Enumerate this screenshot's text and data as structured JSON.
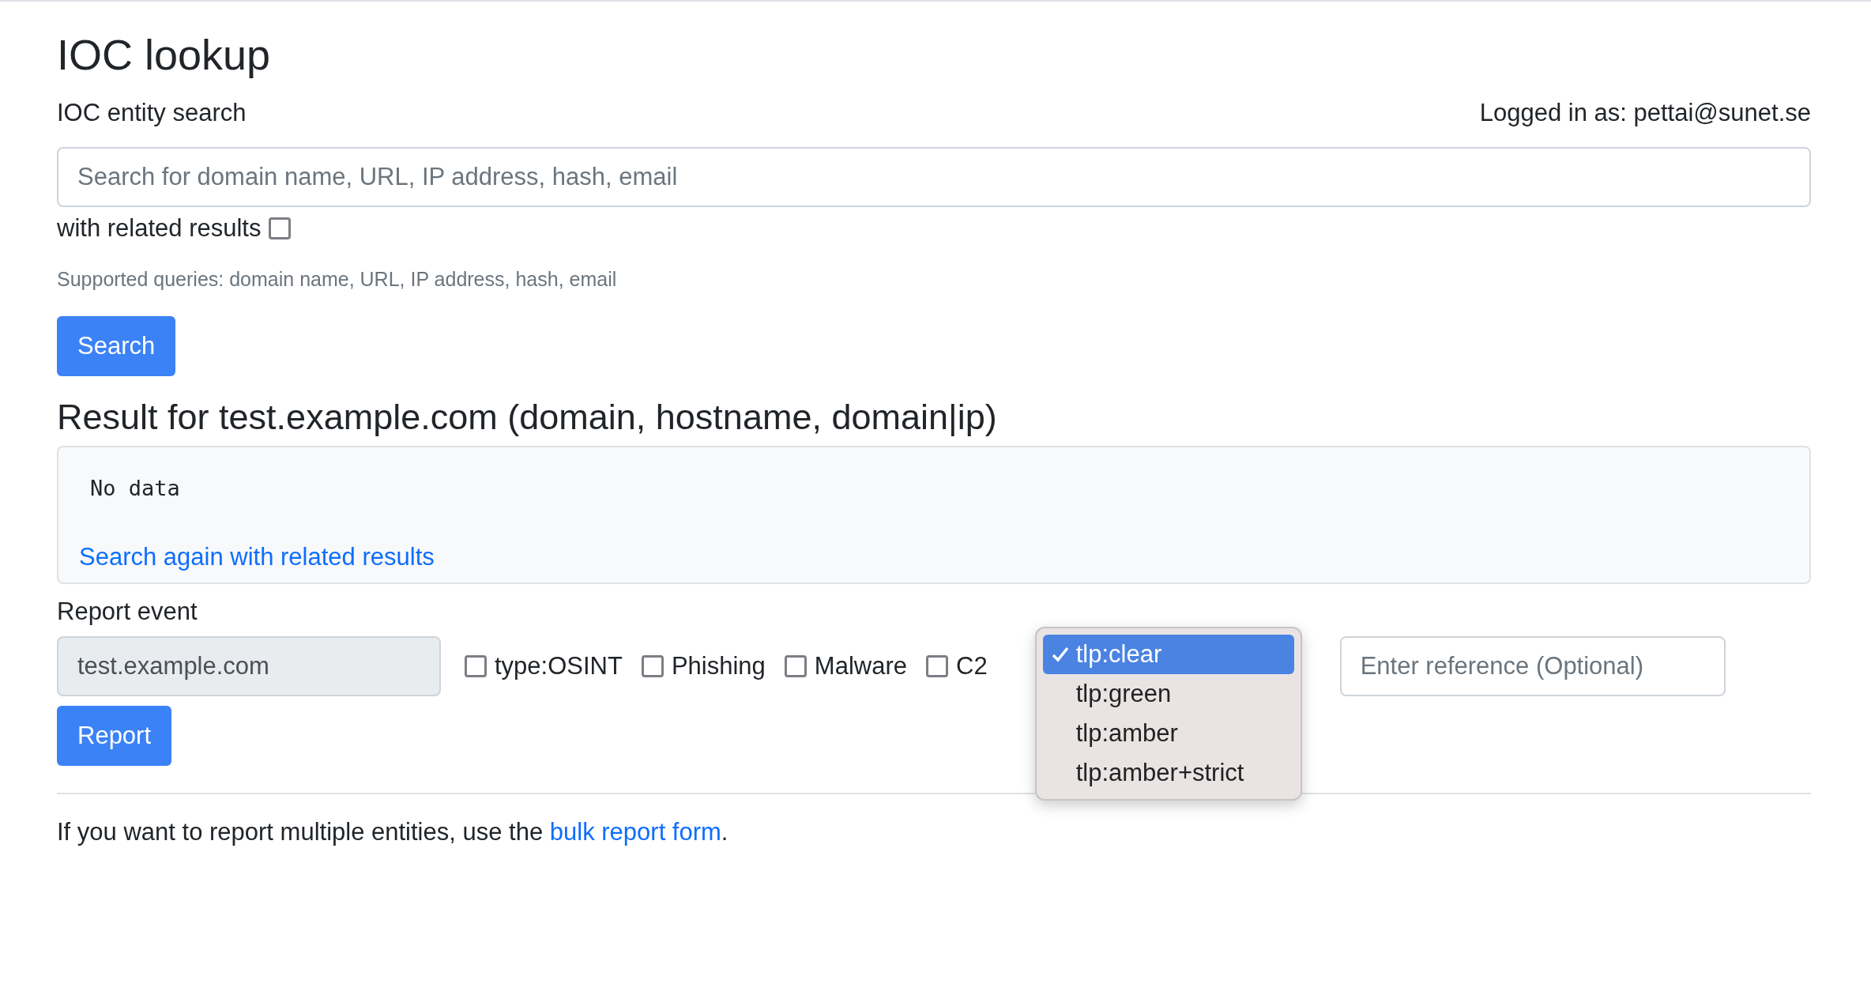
{
  "title": "IOC lookup",
  "search_label": "IOC entity search",
  "logged_in": "Logged in as: pettai@sunet.se",
  "search": {
    "placeholder": "Search for domain name, URL, IP address, hash, email"
  },
  "related": {
    "label": "with related results",
    "checked": false
  },
  "help": "Supported queries: domain name, URL, IP address, hash, email",
  "search_button": "Search",
  "result": {
    "heading": "Result for test.example.com (domain, hostname, domain|ip)",
    "body": "No data",
    "link": "Search again with related results"
  },
  "report": {
    "label": "Report event",
    "entity": "test.example.com",
    "tags": [
      {
        "label": "type:OSINT",
        "checked": false
      },
      {
        "label": "Phishing",
        "checked": false
      },
      {
        "label": "Malware",
        "checked": false
      },
      {
        "label": "C2",
        "checked": false
      }
    ],
    "tlp_options": [
      {
        "label": "tlp:clear",
        "selected": true
      },
      {
        "label": "tlp:green",
        "selected": false
      },
      {
        "label": "tlp:amber",
        "selected": false
      },
      {
        "label": "tlp:amber+strict",
        "selected": false
      }
    ],
    "reference": {
      "placeholder": "Enter reference (Optional)"
    },
    "button": "Report"
  },
  "footer": {
    "text": "If you want to report multiple entities, use the ",
    "link": "bulk report form",
    "end": "."
  }
}
